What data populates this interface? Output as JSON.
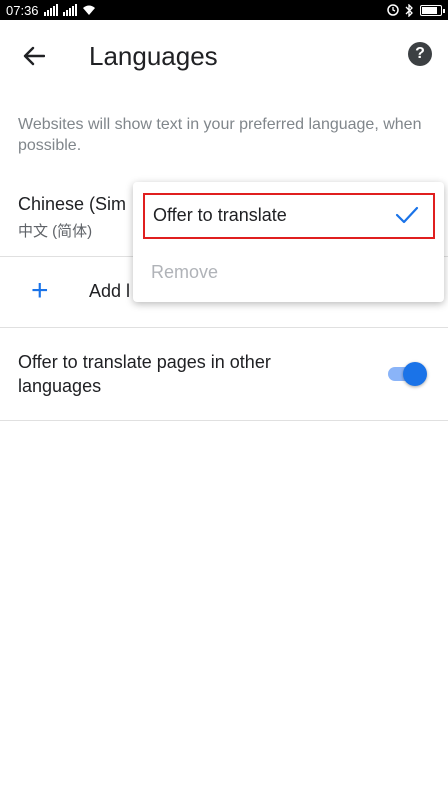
{
  "status_bar": {
    "time": "07:36",
    "network1": "4G",
    "network2": "4G"
  },
  "toolbar": {
    "title": "Languages",
    "help_icon": "help-icon",
    "back_icon": "back-arrow-icon"
  },
  "description": "Websites will show text in your preferred language, when possible.",
  "language_item": {
    "name": "Chinese (Sim",
    "native": "中文 (简体)"
  },
  "add_language": {
    "label": "Add l",
    "icon": "plus-icon"
  },
  "offer_translate_setting": {
    "label": "Offer to translate pages in other languages",
    "enabled": true
  },
  "popup_menu": {
    "items": [
      {
        "label": "Offer to translate",
        "checked": true,
        "enabled": true
      },
      {
        "label": "Remove",
        "enabled": false
      }
    ]
  },
  "colors": {
    "accent": "#1a73e8",
    "highlight": "#e01f1f"
  }
}
